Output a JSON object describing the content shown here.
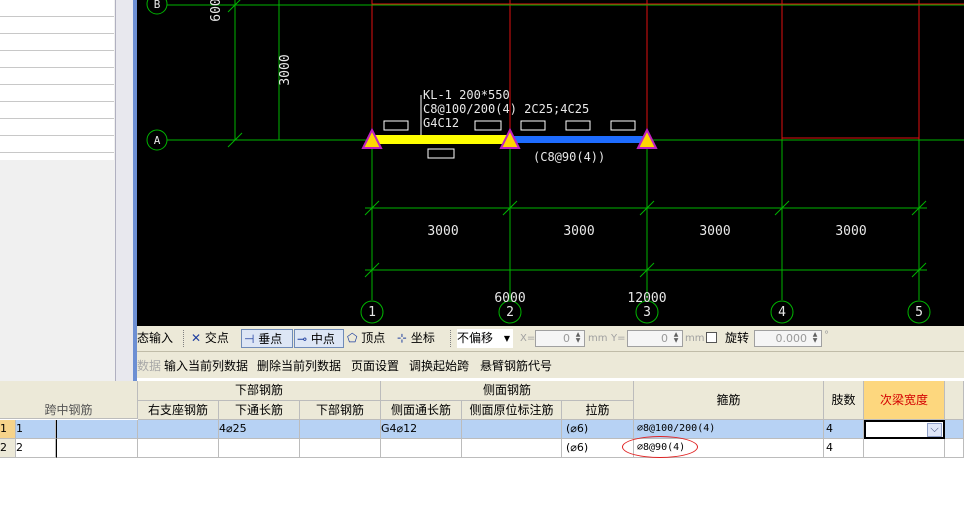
{
  "left_panel": {
    "truncated_header": "跨中钢筋",
    "scroll_down": "▼"
  },
  "canvas": {
    "axes": {
      "row_B": "B",
      "row_A": "A",
      "col_1": "1",
      "col_2": "2",
      "col_3": "3",
      "col_4": "4",
      "col_5": "5"
    },
    "dims": {
      "left_top": "600",
      "left_mid": "3000",
      "span_1": "3000",
      "span_2": "3000",
      "span_3": "3000",
      "span_4": "3000",
      "total_1": "6000",
      "total_2": "12000"
    },
    "beam_label": {
      "line1": "KL-1 200*550",
      "line2": "C8@100/200(4)  2C25;4C25",
      "line3": "G4C12",
      "span_stirrup": "(C8@90(4))"
    },
    "colors": {
      "grid_line": "#00c000",
      "red_line": "#e01010",
      "beam_yellow": "#ffff00",
      "beam_blue": "#1e6cff",
      "support_magenta": "#c020c0",
      "text_white": "#e8e8e8"
    }
  },
  "snap_toolbar": {
    "dynamic_input": "态输入",
    "intersection": "交点",
    "perpendicular": "垂点",
    "midpoint": "中点",
    "vertex": "顶点",
    "coordinate": "坐标",
    "offset_select": "不偏移",
    "x_label": "X=",
    "x_value": "0",
    "y_label": "Y=",
    "y_value": "0",
    "unit": "mm",
    "rotate_label": "旋转",
    "rotate_value": "0.000",
    "degree": "°"
  },
  "cmd_toolbar": {
    "truncated": "数据",
    "input_current_col": "输入当前列数据",
    "delete_current_col": "删除当前列数据",
    "page_setup": "页面设置",
    "swap_start_span": "调换起始跨",
    "cantilever_code": "悬臂钢筋代号"
  },
  "table": {
    "headers": {
      "span_mid_rebar": "跨中钢筋",
      "bottom_rebar_group": "下部钢筋",
      "side_rebar_group": "侧面钢筋",
      "right_support": "右支座钢筋",
      "bottom_through": "下通长筋",
      "bottom_rebar": "下部钢筋",
      "side_through": "侧面通长筋",
      "side_marked": "侧面原位标注筋",
      "tie_bar": "拉筋",
      "stirrup": "箍筋",
      "legs": "肢数",
      "secondary_beam_width": "次梁宽度"
    },
    "rows": [
      {
        "row_index": "1",
        "span": "1",
        "span_mid": "",
        "right_support": "",
        "bottom_through": "4⌀25",
        "bottom_rebar": "",
        "side_through": "G4⌀12",
        "side_marked": "",
        "tie": "(⌀6)",
        "stirrup": "⌀8@100/200(4)",
        "legs": "4",
        "sec_width": ""
      },
      {
        "row_index": "2",
        "span": "2",
        "span_mid": "",
        "right_support": "",
        "bottom_through": "",
        "bottom_rebar": "",
        "side_through": "",
        "side_marked": "",
        "tie": "(⌀6)",
        "stirrup": "⌀8@90(4)",
        "legs": "4",
        "sec_width": ""
      }
    ],
    "dropdown_arrow": "⌵"
  }
}
